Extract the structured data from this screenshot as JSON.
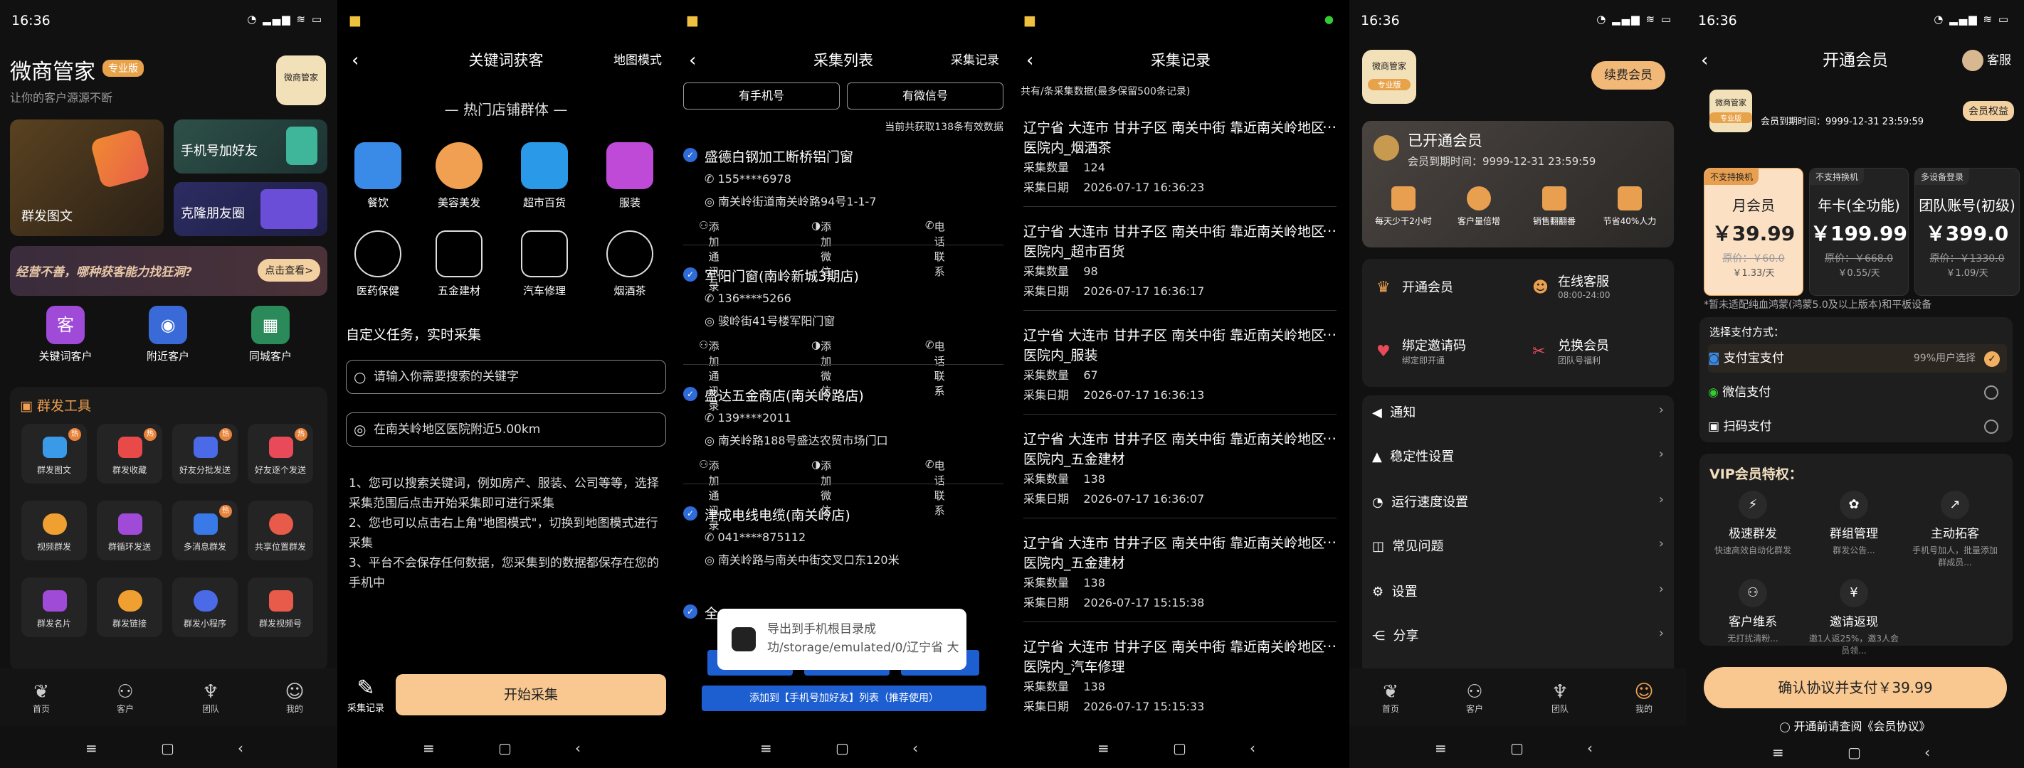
{
  "s1": {
    "time": "16:36",
    "app_title": "微商管家",
    "badge": "专业版",
    "subtitle": "让你的客户源源不断",
    "avatar_text": "微商管家",
    "tile_mass": "群发图文",
    "tile_phone": "手机号加好友",
    "tile_clone": "克隆朋友圈",
    "banner_text": "经营不善，哪种获客能力找狂洞?",
    "banner_btn": "点击查看>",
    "quick": [
      "关键词客户",
      "附近客户",
      "同城客户"
    ],
    "tools_title": "群发工具",
    "tools": [
      "群发图文",
      "群发收藏",
      "好友分批发送",
      "好友逐个发送",
      "视频群发",
      "群循环发送",
      "多消息群发",
      "共享位置群发",
      "群发名片",
      "群发链接",
      "群发小程序",
      "群发视频号"
    ],
    "nav": [
      "首页",
      "客户",
      "团队",
      "我的"
    ]
  },
  "s2": {
    "title": "关键词获客",
    "map_mode": "地图模式",
    "hot_title": "热门店铺群体",
    "cats": [
      "餐饮",
      "美容美发",
      "超市百货",
      "服装",
      "医药保健",
      "五金建材",
      "汽车修理",
      "烟酒茶"
    ],
    "custom_title": "自定义任务，实时采集",
    "search_placeholder": "请输入你需要搜索的关键字",
    "location": "在南关岭地区医院附近5.00km",
    "tips": [
      "1、您可以搜索关键词，例如房产、服装、公司等等，选择采集范围后点击开始采集即可进行采集",
      "2、您也可以点击右上角\"地图模式\"，切换到地图模式进行采集",
      "3、平台不会保存任何数据，您采集到的数据都保存在您的手机中"
    ],
    "record_label": "采集记录",
    "start_btn": "开始采集"
  },
  "s3": {
    "title": "采集列表",
    "record_link": "采集记录",
    "tab1": "有手机号",
    "tab2": "有微信号",
    "count_text": "当前共获取138条有效数据",
    "shops": [
      {
        "name": "盛德白钢加工断桥铝门窗",
        "phone": "155****6978",
        "addr": "南关岭街道南关岭路94号1-1-7"
      },
      {
        "name": "军阳门窗(南岭新城3期店)",
        "phone": "136****5266",
        "addr": "骏岭街41号楼军阳门窗"
      },
      {
        "name": "盛达五金商店(南关岭路店)",
        "phone": "139****2011",
        "addr": "南关岭路188号盛达农贸市场门口"
      },
      {
        "name": "津成电线电缆(南关岭店)",
        "phone": "041****875112",
        "addr": "南关岭路与南关中街交叉口东120米"
      }
    ],
    "act_contact": "添加通讯录",
    "act_wechat": "添加微信",
    "act_call": "电话联系",
    "partial_name": "全",
    "toast_text": "导出到手机根目录成功/storage/emulated/0/辽宁省 大连市 甘...",
    "add_btn": "添加到【手机号加好友】列表（推荐使用）"
  },
  "s4": {
    "title": "采集记录",
    "note": "共有/条采集数据(最多保留500条记录)",
    "count_label": "采集数量",
    "date_label": "采集日期",
    "records": [
      {
        "name": "辽宁省 大连市 甘井子区 南关中街 靠近南关岭地区医院内_烟酒茶",
        "count": "124",
        "date": "2026-07-17 16:36:23"
      },
      {
        "name": "辽宁省 大连市 甘井子区 南关中街 靠近南关岭地区医院内_超市百货",
        "count": "98",
        "date": "2026-07-17 16:36:17"
      },
      {
        "name": "辽宁省 大连市 甘井子区 南关中街 靠近南关岭地区医院内_服装",
        "count": "67",
        "date": "2026-07-17 16:36:13"
      },
      {
        "name": "辽宁省 大连市 甘井子区 南关中街 靠近南关岭地区医院内_五金建材",
        "count": "138",
        "date": "2026-07-17 16:36:07"
      },
      {
        "name": "辽宁省 大连市 甘井子区 南关中街 靠近南关岭地区医院内_五金建材",
        "count": "138",
        "date": "2026-07-17 15:15:38"
      },
      {
        "name": "辽宁省 大连市 甘井子区 南关中街 靠近南关岭地区医院内_汽车修理",
        "count": "138",
        "date": "2026-07-17 15:15:33"
      }
    ]
  },
  "s5": {
    "time": "16:36",
    "renew_btn": "续费会员",
    "avatar_text": "微商管家",
    "avatar_badge": "专业版",
    "vip_title": "已开通会员",
    "vip_expire": "会员到期时间：9999-12-31 23:59:59",
    "benefits": [
      "每天少干2小时",
      "客户量倍增",
      "销售翻翻番",
      "节省40%人力"
    ],
    "grid": [
      {
        "t": "开通会员",
        "s": ""
      },
      {
        "t": "在线客服",
        "s": "08:00-24:00"
      },
      {
        "t": "绑定邀请码",
        "s": "绑定即开通"
      },
      {
        "t": "兑换会员",
        "s": "团队号福利"
      }
    ],
    "menu": [
      "通知",
      "稳定性设置",
      "运行速度设置",
      "常见问题",
      "设置",
      "分享"
    ],
    "nav": [
      "首页",
      "客户",
      "团队",
      "我的"
    ]
  },
  "s6": {
    "time": "16:36",
    "title": "开通会员",
    "service": "客服",
    "avatar_text": "微商管家",
    "avatar_badge": "专业版",
    "expire": "会员到期时间：9999-12-31 23:59:59",
    "rights_btn": "会员权益",
    "plans": [
      {
        "tag": "不支持换机",
        "name": "月会员",
        "price": "￥39.99",
        "orig": "原价：￥60.0",
        "daily": "￥1.33/天"
      },
      {
        "tag": "不支持换机",
        "name": "年卡(全功能)",
        "price": "￥199.99",
        "orig": "原价：￥668.0",
        "daily": "￥0.55/天"
      },
      {
        "tag": "多设备登录",
        "name": "团队账号(初级)",
        "price": "￥399.0",
        "orig": "原价：￥1330.0",
        "daily": "￥1.09/天"
      }
    ],
    "notice": "*暂未适配纯血鸿蒙(鸿蒙5.0及以上版本)和平板设备",
    "pay_title": "选择支付方式：",
    "pay_alipay": "支付宝支付",
    "pay_alipay_hint": "99%用户选择",
    "pay_wechat": "微信支付",
    "pay_scan": "扫码支付",
    "vip_title": "VIP会员特权：",
    "privs": [
      {
        "t": "极速群发",
        "s": "快速高效自动化群发"
      },
      {
        "t": "群组管理",
        "s": "群发公告..."
      },
      {
        "t": "主动拓客",
        "s": "手机号加人，批量添加群成员..."
      },
      {
        "t": "客户维系",
        "s": "无打扰清粉..."
      },
      {
        "t": "邀请返现",
        "s": "邀1人返25%，邀3人会员领..."
      }
    ],
    "confirm_btn": "确认协议并支付￥39.99",
    "agreement": "开通前请查阅《会员协议》"
  }
}
